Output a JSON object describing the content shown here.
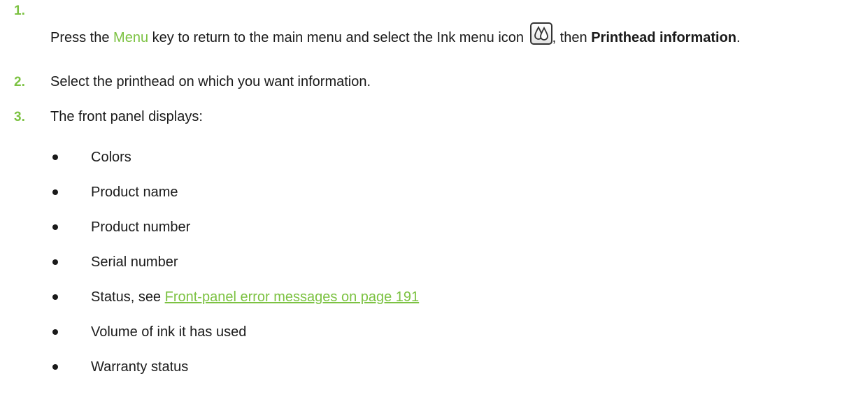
{
  "steps": [
    {
      "number": "1.",
      "text_before": "Press the ",
      "key_label": "Menu",
      "text_mid": " key to return to the main menu and select the Ink menu icon ",
      "icon": "ink-drops-icon",
      "text_after": ", then ",
      "bold_text": "Printhead information",
      "text_end": "."
    },
    {
      "number": "2.",
      "text": "Select the printhead on which you want information."
    },
    {
      "number": "3.",
      "text": "The front panel displays:"
    }
  ],
  "bullets": [
    {
      "text": "Colors"
    },
    {
      "text": "Product name"
    },
    {
      "text": "Product number"
    },
    {
      "text": "Serial number"
    },
    {
      "text": "Status, see ",
      "link": "Front-panel error messages on page 191"
    },
    {
      "text": "Volume of ink it has used"
    },
    {
      "text": "Warranty status"
    }
  ],
  "colors": {
    "accent": "#7cc242",
    "text": "#1a1a1a"
  }
}
